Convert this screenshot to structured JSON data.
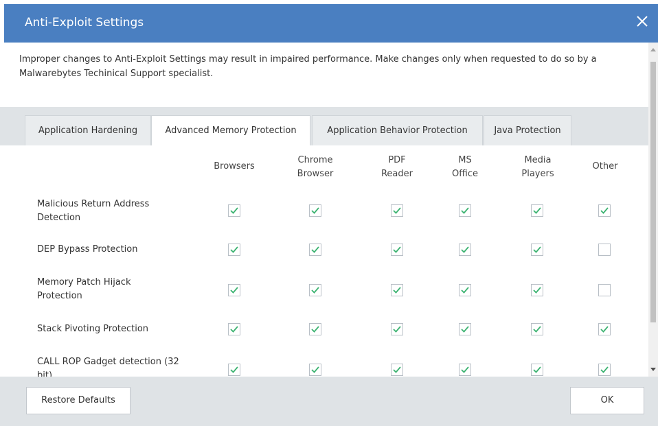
{
  "dialog": {
    "title": "Anti-Exploit Settings",
    "close_icon": "close-icon",
    "warning": "Improper changes to Anti-Exploit Settings may result in impaired performance. Make changes only when requested to do so by a Malwarebytes Techinical Support specialist."
  },
  "tabs": [
    {
      "label": "Application Hardening",
      "active": false
    },
    {
      "label": "Advanced Memory Protection",
      "active": true
    },
    {
      "label": "Application Behavior Protection",
      "active": false
    },
    {
      "label": "Java Protection",
      "active": false
    }
  ],
  "columns": [
    {
      "line1": "Browsers",
      "line2": ""
    },
    {
      "line1": "Chrome",
      "line2": "Browser"
    },
    {
      "line1": "PDF",
      "line2": "Reader"
    },
    {
      "line1": "MS",
      "line2": "Office"
    },
    {
      "line1": "Media",
      "line2": "Players"
    },
    {
      "line1": "Other",
      "line2": ""
    }
  ],
  "rows": [
    {
      "line1": "Malicious Return Address",
      "line2": "Detection",
      "checked": [
        true,
        true,
        true,
        true,
        true,
        true
      ]
    },
    {
      "line1": "DEP Bypass Protection",
      "line2": "",
      "checked": [
        true,
        true,
        true,
        true,
        true,
        false
      ]
    },
    {
      "line1": "Memory Patch Hijack",
      "line2": "Protection",
      "checked": [
        true,
        true,
        true,
        true,
        true,
        false
      ]
    },
    {
      "line1": "Stack Pivoting Protection",
      "line2": "",
      "checked": [
        true,
        true,
        true,
        true,
        true,
        true
      ]
    },
    {
      "line1": "CALL ROP Gadget detection (32",
      "line2": "bit)",
      "checked": [
        true,
        true,
        true,
        true,
        true,
        true
      ]
    }
  ],
  "footer": {
    "restore_label": "Restore Defaults",
    "ok_label": "OK"
  },
  "colors": {
    "titlebar": "#4a7fc1",
    "check": "#3cb371"
  }
}
